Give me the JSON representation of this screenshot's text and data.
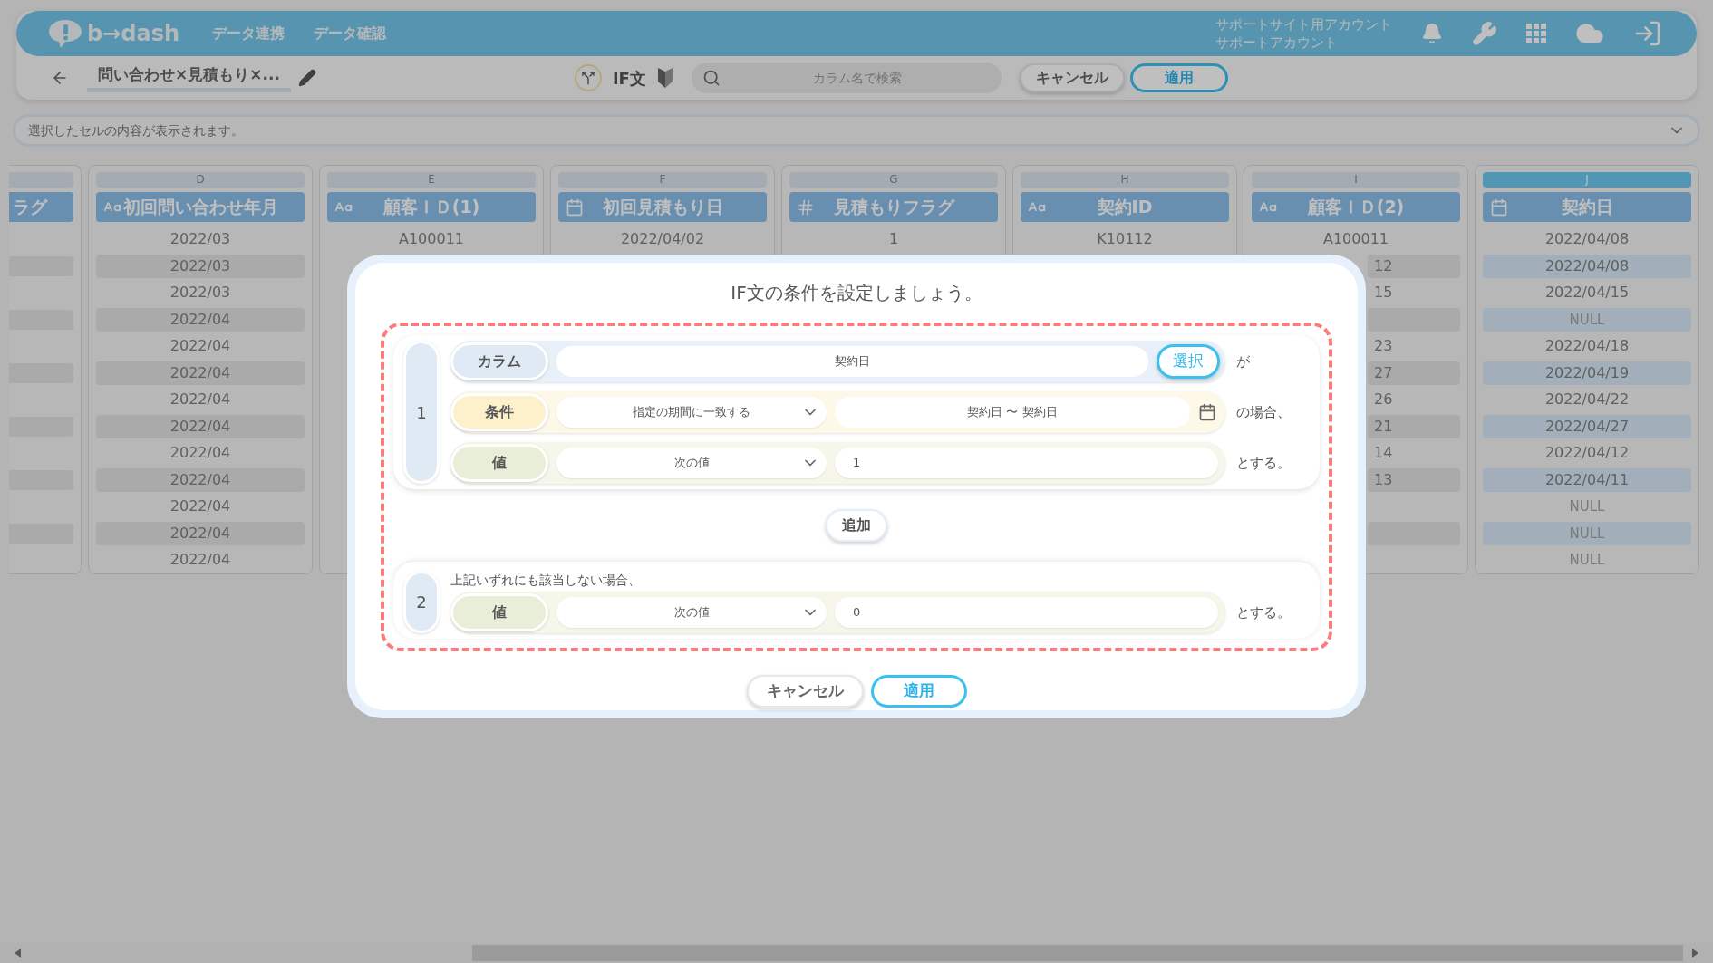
{
  "header": {
    "logo": "b→dash",
    "nav": [
      {
        "label": "データ連携"
      },
      {
        "label": "データ確認"
      }
    ],
    "account": [
      "サポートサイト用アカウント",
      "サポートアカウント"
    ]
  },
  "toolbar": {
    "title": "問い合わせ×見積もり×...",
    "mode_label": "IF文",
    "search": {
      "placeholder": "カラム名で検索"
    },
    "buttons": [
      {
        "label": "キャンセル",
        "kind": "secondary"
      },
      {
        "label": "適用",
        "kind": "primary"
      }
    ]
  },
  "cell_preview": {
    "placeholder": "選択したセルの内容が表示されます。"
  },
  "table": {
    "columns": [
      {
        "clipped": true,
        "name": "ラグ",
        "selected": false
      },
      {
        "clipped": false,
        "letter": "D",
        "name": "初回問い合わせ年月",
        "kind": "text",
        "selected": false,
        "cells": [
          {
            "text": "2022/03",
            "kind": "value"
          },
          {
            "text": "2022/03",
            "kind": "value"
          },
          {
            "text": "2022/03",
            "kind": "value"
          },
          {
            "text": "2022/04",
            "kind": "value"
          },
          {
            "text": "2022/04",
            "kind": "value"
          },
          {
            "text": "2022/04",
            "kind": "value"
          },
          {
            "text": "2022/04",
            "kind": "value"
          },
          {
            "text": "2022/04",
            "kind": "value"
          },
          {
            "text": "2022/04",
            "kind": "value"
          },
          {
            "text": "2022/04",
            "kind": "value"
          },
          {
            "text": "2022/04",
            "kind": "value"
          },
          {
            "text": "2022/04",
            "kind": "value"
          },
          {
            "text": "2022/04",
            "kind": "value"
          }
        ]
      },
      {
        "clipped": false,
        "letter": "E",
        "name": "顧客ＩＤ(1)",
        "kind": "text",
        "selected": false,
        "cells": [
          {
            "text": "A100011",
            "kind": "value"
          }
        ]
      },
      {
        "clipped": false,
        "letter": "F",
        "name": "初回見積もり日",
        "kind": "date",
        "selected": false,
        "cells": [
          {
            "text": "2022/04/02",
            "kind": "value"
          }
        ]
      },
      {
        "clipped": false,
        "letter": "G",
        "name": "見積もりフラグ",
        "kind": "number",
        "selected": false,
        "cells": [
          {
            "text": "1",
            "kind": "value"
          }
        ]
      },
      {
        "clipped": false,
        "letter": "H",
        "name": "契約ID",
        "kind": "text",
        "selected": false,
        "cells": [
          {
            "text": "K10112",
            "kind": "value"
          }
        ]
      },
      {
        "clipped": false,
        "letter": "I",
        "name": "顧客ＩＤ(2)",
        "kind": "text",
        "selected": false,
        "cells": [
          {
            "text": "A100011",
            "kind": "value"
          },
          {
            "text": "12",
            "kind": "partial"
          },
          {
            "text": "15",
            "kind": "partial"
          },
          {
            "kind": "blank"
          },
          {
            "text": "23",
            "kind": "partial"
          },
          {
            "text": "27",
            "kind": "partial"
          },
          {
            "text": "26",
            "kind": "partial"
          },
          {
            "text": "21",
            "kind": "partial"
          },
          {
            "text": "14",
            "kind": "partial"
          },
          {
            "text": "13",
            "kind": "partial"
          },
          {
            "kind": "blank"
          },
          {
            "kind": "blank"
          },
          {
            "kind": "blank"
          }
        ]
      },
      {
        "clipped": false,
        "letter": "J",
        "name": "契約日",
        "kind": "date",
        "selected": true,
        "cells": [
          {
            "text": "2022/04/08",
            "kind": "value"
          },
          {
            "text": "2022/04/08",
            "kind": "value"
          },
          {
            "text": "2022/04/15",
            "kind": "value"
          },
          {
            "text": "NULL",
            "kind": "null"
          },
          {
            "text": "2022/04/18",
            "kind": "value"
          },
          {
            "text": "2022/04/19",
            "kind": "value"
          },
          {
            "text": "2022/04/22",
            "kind": "value"
          },
          {
            "text": "2022/04/27",
            "kind": "value"
          },
          {
            "text": "2022/04/12",
            "kind": "value"
          },
          {
            "text": "2022/04/11",
            "kind": "value"
          },
          {
            "text": "NULL",
            "kind": "null"
          },
          {
            "text": "NULL",
            "kind": "null"
          },
          {
            "text": "NULL",
            "kind": "null"
          }
        ]
      }
    ]
  },
  "dialog": {
    "title": "IF文の条件を設定しましょう。",
    "rules": [
      {
        "number": "1",
        "column": {
          "label": "カラム",
          "value": "契約日",
          "button": "選択",
          "suffix": "が"
        },
        "condition": {
          "label": "条件",
          "operator": "指定の期間に一致する",
          "value": "契約日 〜 契約日",
          "suffix": "の場合、"
        },
        "result": {
          "label": "値",
          "mode": "次の値",
          "value": "1",
          "suffix": "とする。"
        }
      }
    ],
    "add_button": "追加",
    "else_rule": {
      "number": "2",
      "note": "上記いずれにも該当しない場合、",
      "result": {
        "label": "値",
        "mode": "次の値",
        "value": "0",
        "suffix": "とする。"
      }
    },
    "buttons": [
      {
        "label": "キャンセル",
        "kind": "secondary"
      },
      {
        "label": "適用",
        "kind": "primary"
      }
    ]
  }
}
